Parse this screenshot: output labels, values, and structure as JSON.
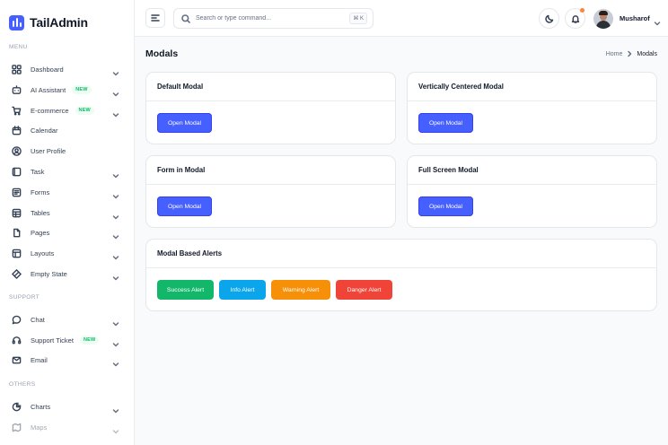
{
  "app": {
    "name": "TailAdmin"
  },
  "sidebar": {
    "sections": {
      "menu": "MENU",
      "support": "SUPPORT",
      "others": "OTHERS"
    },
    "items": [
      {
        "label": "Dashboard",
        "icon": "grid-icon",
        "badge": "",
        "chevron": true
      },
      {
        "label": "AI Assistant",
        "icon": "ai-icon",
        "badge": "NEW",
        "chevron": true
      },
      {
        "label": "E-commerce",
        "icon": "cart-icon",
        "badge": "NEW",
        "chevron": true
      },
      {
        "label": "Calendar",
        "icon": "calendar-icon",
        "badge": "",
        "chevron": false
      },
      {
        "label": "User Profile",
        "icon": "user-icon",
        "badge": "",
        "chevron": false
      },
      {
        "label": "Task",
        "icon": "task-icon",
        "badge": "",
        "chevron": true
      },
      {
        "label": "Forms",
        "icon": "forms-icon",
        "badge": "",
        "chevron": true
      },
      {
        "label": "Tables",
        "icon": "table-icon",
        "badge": "",
        "chevron": true
      },
      {
        "label": "Pages",
        "icon": "pages-icon",
        "badge": "",
        "chevron": true
      },
      {
        "label": "Layouts",
        "icon": "layout-icon",
        "badge": "",
        "chevron": true
      },
      {
        "label": "Empty State",
        "icon": "empty-state-icon",
        "badge": "",
        "chevron": true
      },
      {
        "label": "Chat",
        "icon": "chat-icon",
        "badge": "",
        "chevron": true
      },
      {
        "label": "Support Ticket",
        "icon": "headset-icon",
        "badge": "NEW",
        "chevron": true
      },
      {
        "label": "Email",
        "icon": "mail-icon",
        "badge": "",
        "chevron": true
      },
      {
        "label": "Charts",
        "icon": "pie-chart-icon",
        "badge": "",
        "chevron": true
      },
      {
        "label": "Maps",
        "icon": "map-icon",
        "badge": "",
        "chevron": true
      }
    ]
  },
  "header": {
    "search_placeholder": "Search or type command...",
    "search_shortcut": "⌘ K",
    "user_name": "Musharof"
  },
  "page": {
    "title": "Modals",
    "breadcrumb": {
      "home": "Home",
      "current": "Modals"
    }
  },
  "cards": {
    "default_modal": {
      "title": "Default Modal",
      "button": "Open Modal"
    },
    "centered_modal": {
      "title": "Vertically Centered Modal",
      "button": "Open Modal"
    },
    "form_modal": {
      "title": "Form in Modal",
      "button": "Open Modal"
    },
    "fullscreen_modal": {
      "title": "Full Screen Modal",
      "button": "Open Modal"
    },
    "alerts": {
      "title": "Modal Based Alerts",
      "success": "Success Alert",
      "info": "Info Alert",
      "warning": "Warning Alert",
      "danger": "Danger Alert"
    }
  },
  "colors": {
    "brand": "#465fff",
    "success": "#12b76a",
    "info": "#0ba5ec",
    "warning": "#f79009",
    "danger": "#f04438",
    "notification_dot": "#fd853a"
  }
}
